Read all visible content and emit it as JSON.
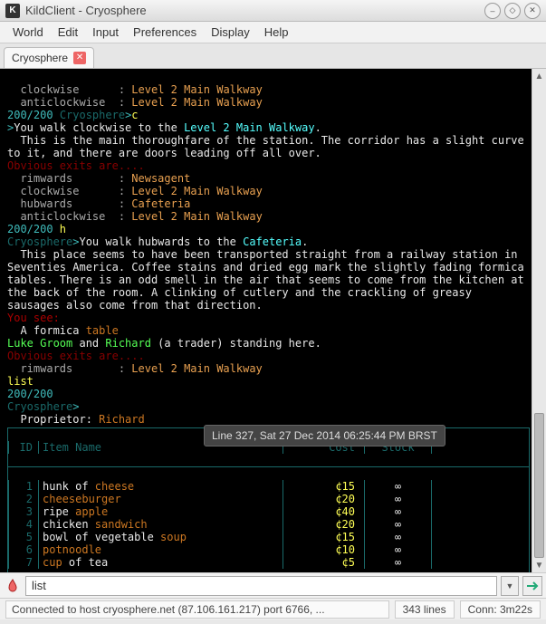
{
  "window": {
    "title": "KildClient - Cryosphere"
  },
  "menu": [
    "World",
    "Edit",
    "Input",
    "Preferences",
    "Display",
    "Help"
  ],
  "tab": {
    "label": "Cryosphere"
  },
  "tooltip": "Line 327, Sat 27 Dec 2014 06:25:44 PM BRST",
  "hp": "200/200",
  "prompt_world": "Cryosphere",
  "text": {
    "clockwise": "clockwise",
    "anticlockwise": "anticlockwise",
    "rimwards": "rimwards",
    "hubwards": "hubwards",
    "l2mw": "Level 2 Main Walkway",
    "newsagent": "Newsagent",
    "cafeteria": "Cafeteria",
    "walk_clock": "You walk clockwise to the ",
    "walk_hub": "You walk hubwards to the ",
    "dot": ".",
    "corridor1": "  This is the main thoroughfare of the station. The corridor has a slight curve",
    "corridor2": "to it, and there are doors leading off all over.",
    "exits": "Obvious exits are....",
    "cafe1": "  This place seems to have been transported straight from a railway station in",
    "cafe2": "Seventies America. Coffee stains and dried egg mark the slightly fading formica",
    "cafe3": "tables. There is an odd smell in the air that seems to come from the kitchen at",
    "cafe4": "the back of the room. A clinking of cutlery and the crackling of greasy",
    "cafe5": "sausages also come from that direction.",
    "yousee": "You see:",
    "formica_a": "  A formica ",
    "formica_b": "table",
    "luke": "Luke Groom",
    "and": " and ",
    "richard": "Richard",
    "trader": " (a trader) standing here.",
    "list": "list",
    "h": " h",
    "c": "c",
    "proprietor": "  Proprietor: ",
    "proprietor_name": "Richard",
    "gt": ">"
  },
  "table": {
    "hdr": {
      "id": "ID",
      "name": "Item Name",
      "cost": "Cost",
      "stock": "Stock"
    },
    "rows": [
      {
        "id": "1",
        "n1": "hunk of ",
        "n2": "cheese",
        "n3": "",
        "cost": "¢15",
        "stock": "∞"
      },
      {
        "id": "2",
        "n1": "",
        "n2": "cheeseburger",
        "n3": "",
        "cost": "¢20",
        "stock": "∞"
      },
      {
        "id": "3",
        "n1": "ripe ",
        "n2": "apple",
        "n3": "",
        "cost": "¢40",
        "stock": "∞"
      },
      {
        "id": "4",
        "n1": "chicken ",
        "n2": "sandwich",
        "n3": "",
        "cost": "¢20",
        "stock": "∞"
      },
      {
        "id": "5",
        "n1": "bowl of vegetable ",
        "n2": "soup",
        "n3": "",
        "cost": "¢15",
        "stock": "∞"
      },
      {
        "id": "6",
        "n1": "",
        "n2": "potnoodle",
        "n3": "",
        "cost": "¢10",
        "stock": "∞"
      },
      {
        "id": "7",
        "n1": "",
        "n2": "cup",
        "n3": " of tea",
        "cost": "¢5",
        "stock": "∞"
      }
    ]
  },
  "input": {
    "value": "list"
  },
  "status": {
    "connection": "Connected to host cryosphere.net (87.106.161.217) port 6766, ...",
    "lines": "343 lines",
    "conn_time": "Conn: 3m22s"
  }
}
